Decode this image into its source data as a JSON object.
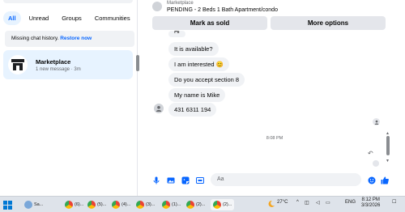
{
  "filters": {
    "all": "All",
    "unread": "Unread",
    "groups": "Groups",
    "communities": "Communities"
  },
  "notice": {
    "text": "Missing chat history.",
    "link": "Restore now"
  },
  "conversation": {
    "name": "Marketplace",
    "subtitle": "1 new message · 3m"
  },
  "chat_header": {
    "title": "Marketplace",
    "listing": "PENDING - 2 Beds 1 Bath Apartment/condo"
  },
  "actions": {
    "mark_sold": "Mark as sold",
    "more_options": "More options"
  },
  "messages": [
    {
      "text": "It is available?"
    },
    {
      "text": "I am interested",
      "emoji": "😊"
    },
    {
      "text": "Do you accept section 8"
    },
    {
      "text": "My name is Mike"
    },
    {
      "text": "431 6311 194"
    }
  ],
  "timestamp": "8:08 PM",
  "composer": {
    "placeholder": "Aa"
  },
  "taskbar": {
    "items": [
      {
        "icon": "weather-icon",
        "label": "Sa..."
      },
      {
        "icon": "chrome-icon",
        "label": "(6)..."
      },
      {
        "icon": "chrome-icon",
        "label": "(5)..."
      },
      {
        "icon": "chrome-icon",
        "label": "(4)..."
      },
      {
        "icon": "chrome-icon",
        "label": "(3)..."
      },
      {
        "icon": "chrome-icon",
        "label": "(1)..."
      },
      {
        "icon": "chrome-icon",
        "label": "(2)..."
      },
      {
        "icon": "chrome-icon",
        "label": "(2)..."
      }
    ],
    "temperature": "27°C",
    "language": "ENG",
    "time": "8:12 PM",
    "date": "3/3/2026"
  },
  "colors": {
    "accent": "#0866ff",
    "bubble": "#f0f2f5",
    "selected": "#e7f3ff",
    "taskbar": "#dee3ea"
  }
}
